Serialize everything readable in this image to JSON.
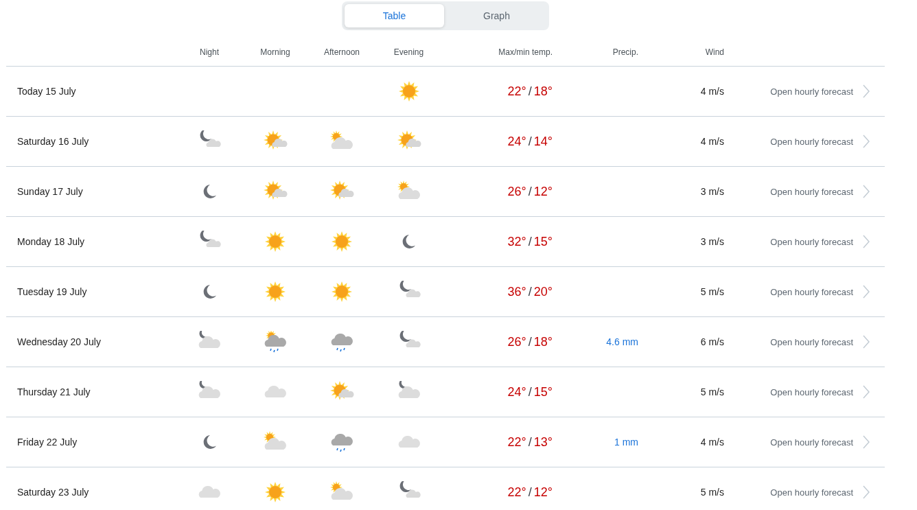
{
  "view_tabs": [
    {
      "label": "Table",
      "selected": true
    },
    {
      "label": "Graph",
      "selected": false
    }
  ],
  "columns": {
    "night": "Night",
    "morning": "Morning",
    "afternoon": "Afternoon",
    "evening": "Evening",
    "temp": "Max/min temp.",
    "precip": "Precip.",
    "wind": "Wind"
  },
  "rows": [
    {
      "day": "Today 15 July",
      "evening": {
        "kind": "sun"
      },
      "max": "22°",
      "separator": "/",
      "min": "18°",
      "wind": "4 m/s",
      "link": "Open hourly forecast"
    },
    {
      "day": "Saturday 16 July",
      "night": {
        "kind": "moon-cloud"
      },
      "morning": {
        "kind": "sun-cloud"
      },
      "afternoon": {
        "kind": "cloud-sun"
      },
      "evening": {
        "kind": "sun-cloud"
      },
      "max": "24°",
      "separator": "/",
      "min": "14°",
      "wind": "4 m/s",
      "link": "Open hourly forecast"
    },
    {
      "day": "Sunday 17 July",
      "night": {
        "kind": "moon"
      },
      "morning": {
        "kind": "sun-cloud"
      },
      "afternoon": {
        "kind": "sun-cloud"
      },
      "evening": {
        "kind": "cloud-sun"
      },
      "max": "26°",
      "separator": "/",
      "min": "12°",
      "wind": "3 m/s",
      "link": "Open hourly forecast"
    },
    {
      "day": "Monday 18 July",
      "night": {
        "kind": "moon-cloud"
      },
      "morning": {
        "kind": "sun"
      },
      "afternoon": {
        "kind": "sun"
      },
      "evening": {
        "kind": "moon"
      },
      "max": "32°",
      "separator": "/",
      "min": "15°",
      "wind": "3 m/s",
      "link": "Open hourly forecast"
    },
    {
      "day": "Tuesday 19 July",
      "night": {
        "kind": "moon"
      },
      "morning": {
        "kind": "sun"
      },
      "afternoon": {
        "kind": "sun"
      },
      "evening": {
        "kind": "moon-cloud"
      },
      "max": "36°",
      "separator": "/",
      "min": "20°",
      "wind": "5 m/s",
      "link": "Open hourly forecast"
    },
    {
      "day": "Wednesday 20 July",
      "night": {
        "kind": "cloud-moon"
      },
      "morning": {
        "kind": "sun-rain"
      },
      "afternoon": {
        "kind": "rain"
      },
      "evening": {
        "kind": "moon-cloud"
      },
      "max": "26°",
      "separator": "/",
      "min": "18°",
      "precip": "4.6 mm",
      "wind": "6 m/s",
      "link": "Open hourly forecast"
    },
    {
      "day": "Thursday 21 July",
      "night": {
        "kind": "cloud-moon"
      },
      "morning": {
        "kind": "cloud"
      },
      "afternoon": {
        "kind": "sun-cloud"
      },
      "evening": {
        "kind": "cloud-moon"
      },
      "max": "24°",
      "separator": "/",
      "min": "15°",
      "wind": "5 m/s",
      "link": "Open hourly forecast"
    },
    {
      "day": "Friday 22 July",
      "night": {
        "kind": "moon"
      },
      "morning": {
        "kind": "cloud-sun"
      },
      "afternoon": {
        "kind": "rain"
      },
      "evening": {
        "kind": "cloud"
      },
      "max": "22°",
      "separator": "/",
      "min": "13°",
      "precip": "1 mm",
      "wind": "4 m/s",
      "link": "Open hourly forecast"
    },
    {
      "day": "Saturday 23 July",
      "night": {
        "kind": "cloud"
      },
      "morning": {
        "kind": "sun"
      },
      "afternoon": {
        "kind": "cloud-sun"
      },
      "evening": {
        "kind": "moon-cloud"
      },
      "max": "22°",
      "separator": "/",
      "min": "12°",
      "wind": "5 m/s",
      "link": "Open hourly forecast"
    }
  ]
}
